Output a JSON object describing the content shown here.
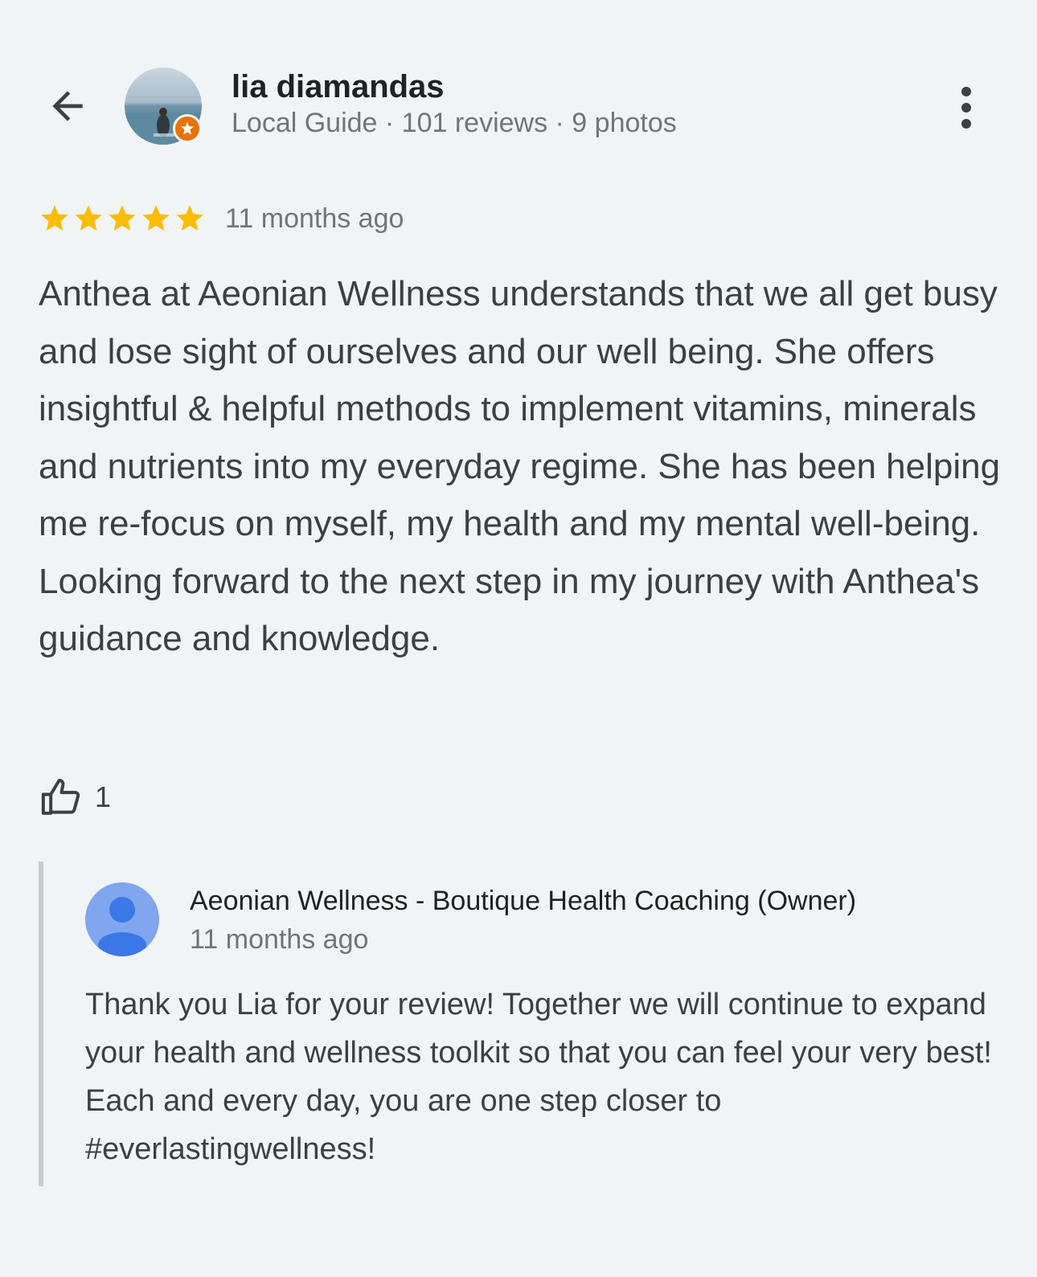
{
  "reviewer": {
    "name": "lia diamandas",
    "meta": "Local Guide · 101 reviews · 9 photos",
    "avatar_icon": "user-photo-avatar",
    "badge_icon": "local-guide-star-badge"
  },
  "review": {
    "rating": 5,
    "max_rating": 5,
    "time_ago": "11 months ago",
    "text": "Anthea at Aeonian Wellness understands that we all get busy and lose sight of ourselves and our well being. She offers insightful & helpful methods to implement vitamins, minerals and nutrients into my everyday regime. She has been helping me re-focus on myself, my health and my mental well-being. Looking forward to the next step in my journey with Anthea's guidance and knowledge.",
    "likes": "1"
  },
  "owner_reply": {
    "name": "Aeonian Wellness - Boutique Health Coaching (Owner)",
    "time_ago": "11 months ago",
    "text": "Thank you Lia for your review! Together we will continue to expand your health and wellness toolkit so that you can feel your very best! Each and every day, you are one step closer to #everlastingwellness!",
    "avatar_icon": "default-person-icon"
  },
  "icons": {
    "back": "arrow-back-icon",
    "more": "more-vert-icon",
    "star": "star-icon",
    "like": "thumb-up-icon"
  },
  "colors": {
    "background": "#f1f4f5",
    "star": "#fbbc04",
    "badge": "#e8710a",
    "owner_avatar": "#7fa6ee",
    "reply_border": "#c8cbcf"
  }
}
